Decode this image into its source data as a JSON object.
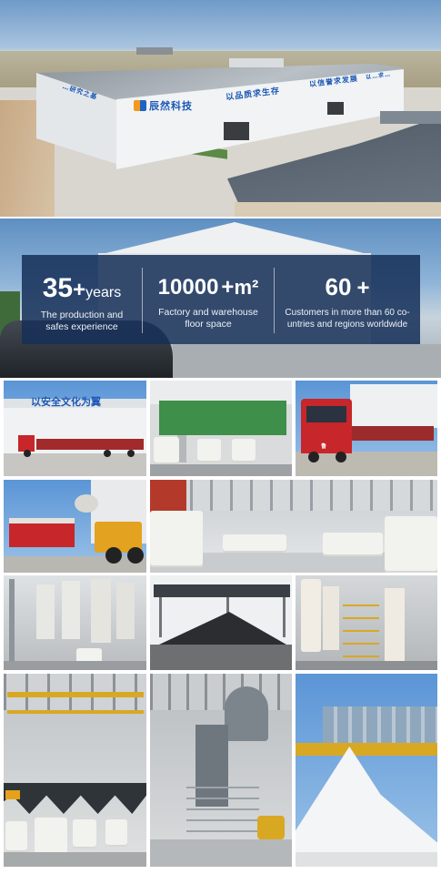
{
  "aerial": {
    "logo_text": "辰然科技",
    "sign_left": "…研究之基",
    "sign_mid": "以品质求生存",
    "sign_right": "以信誉求发展",
    "sign_far": "以…求…"
  },
  "stats": [
    {
      "number": "35",
      "plus": "+",
      "unit": "years",
      "desc_line1": "The production and",
      "desc_line2": "safes experience"
    },
    {
      "number": "10000",
      "plus": "+",
      "unit": "m²",
      "desc_line1": "Factory and warehouse",
      "desc_line2": "floor space"
    },
    {
      "number": "60",
      "plus": "+",
      "unit": "",
      "desc_line1": "Customers in more than 60 co-",
      "desc_line2": "untries and regions worldwide"
    }
  ],
  "gallery": {
    "slogan": "以安全文化为翼",
    "truck_plate": "鲁"
  },
  "colors": {
    "banner_overlay": "#163058",
    "sign_blue": "#1a57b5",
    "truck_red": "#c7262a",
    "powder_white": "#f4f5f6"
  }
}
